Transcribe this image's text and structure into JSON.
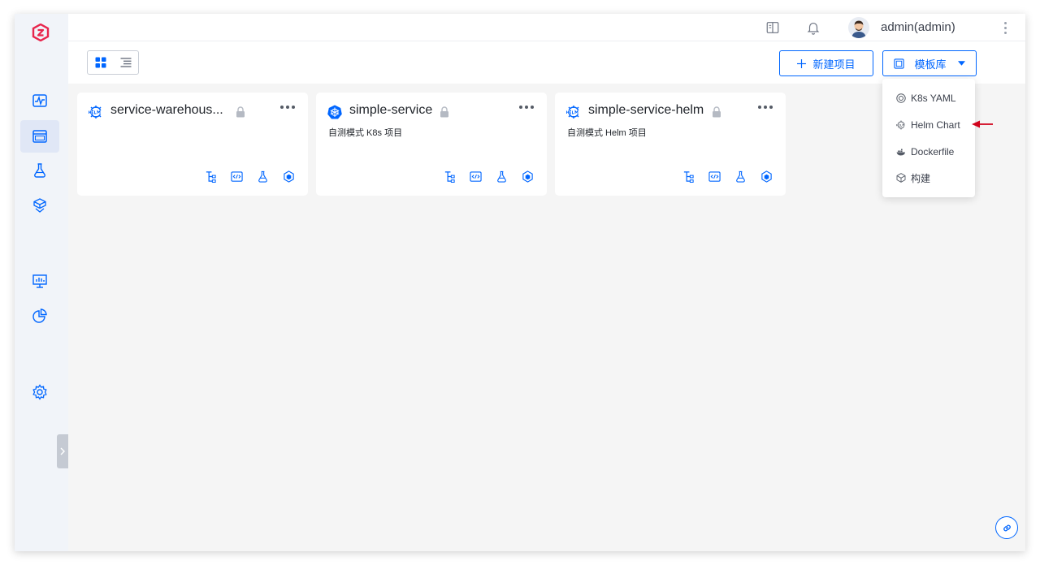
{
  "colors": {
    "accent": "#0066ff",
    "logo": "#e8254c",
    "annotation_arrow": "#d0021b"
  },
  "header": {
    "username": "admin(admin)",
    "icons": [
      "doc-icon",
      "bell-icon",
      "avatar",
      "more-vert-icon"
    ]
  },
  "toolbar": {
    "new_project_label": "新建项目",
    "template_library_label": "模板库",
    "view_modes": [
      "grid-view-icon",
      "list-view-icon"
    ],
    "active_view": "grid"
  },
  "sidebar": {
    "items": [
      "monitor-icon",
      "project-icon",
      "test-icon",
      "delivery-icon",
      "dashboard-icon",
      "analytics-icon",
      "settings-icon"
    ],
    "active": "project-icon"
  },
  "projects": [
    {
      "title": "service-warehous...",
      "description": "",
      "type_icon": "helm-icon",
      "locked": true
    },
    {
      "title": "simple-service",
      "description": "自测模式 K8s 项目",
      "type_icon": "k8s-icon",
      "locked": true
    },
    {
      "title": "simple-service-helm",
      "description": "自测模式 Helm 项目",
      "type_icon": "helm-icon",
      "locked": true
    }
  ],
  "template_menu": {
    "items": [
      {
        "label": "K8s YAML",
        "icon": "k8s-yaml-icon"
      },
      {
        "label": "Helm Chart",
        "icon": "helm-chart-icon"
      },
      {
        "label": "Dockerfile",
        "icon": "docker-icon"
      },
      {
        "label": "构建",
        "icon": "build-icon"
      }
    ],
    "highlighted": "Helm Chart"
  }
}
